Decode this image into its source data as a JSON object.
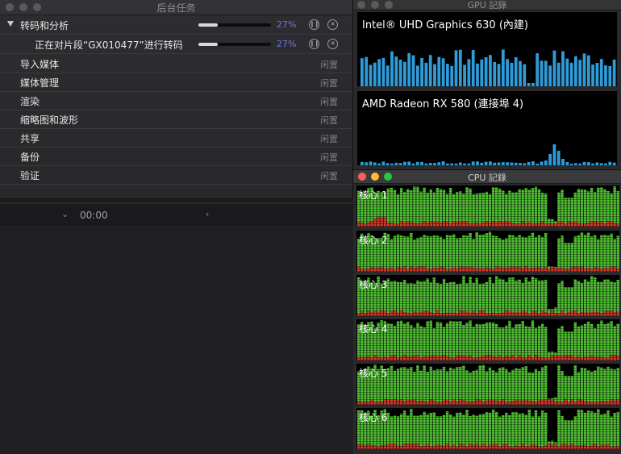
{
  "background_tasks": {
    "title": "后台任务",
    "transcoding": {
      "label": "转码和分析",
      "percent_text": "27%",
      "progress": 0.27
    },
    "subtask": {
      "label": "正在对片段“GX010477”进行转码",
      "percent_text": "27%",
      "progress": 0.27
    },
    "categories": [
      {
        "label": "导入媒体",
        "status": "闲置"
      },
      {
        "label": "媒体管理",
        "status": "闲置"
      },
      {
        "label": "渲染",
        "status": "闲置"
      },
      {
        "label": "缩略图和波形",
        "status": "闲置"
      },
      {
        "label": "共享",
        "status": "闲置"
      },
      {
        "label": "备份",
        "status": "闲置"
      },
      {
        "label": "验证",
        "status": "闲置"
      }
    ]
  },
  "timeline": {
    "timecode": "00:00"
  },
  "gpu_history": {
    "title": "GPU 記錄",
    "gpus": [
      {
        "name": "Intel® UHD Graphics 630 (內建)",
        "color": "#2f9bd8"
      },
      {
        "name": "AMD Radeon RX 580 (連接埠 4)",
        "color": "#2f9bd8"
      }
    ]
  },
  "cpu_history": {
    "title": "CPU 記錄",
    "cores": [
      "核心 1",
      "核心 2",
      "核心 3",
      "核心 4",
      "核心 5",
      "核心 6"
    ],
    "colors": {
      "user": "#52c234",
      "system": "#d23b2b"
    }
  }
}
